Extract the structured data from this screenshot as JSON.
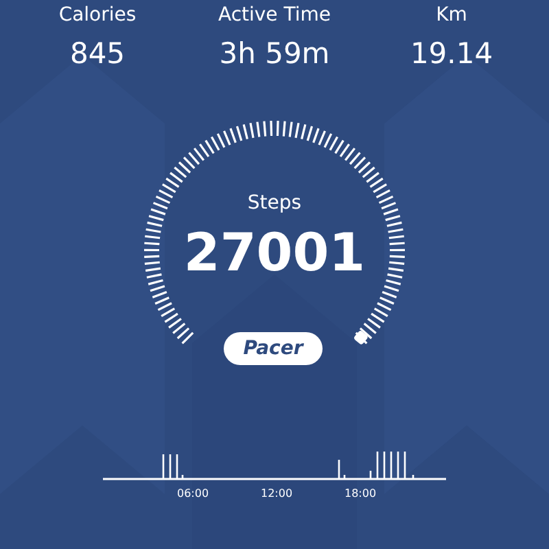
{
  "stats": [
    {
      "label": "Calories",
      "value": "845"
    },
    {
      "label": "Active Time",
      "value": "3h 59m"
    },
    {
      "label": "Km",
      "value": "19.14"
    }
  ],
  "gauge": {
    "label": "Steps",
    "value": "27001"
  },
  "brand": "Pacer",
  "activity_chart": {
    "x_labels": [
      "06:00",
      "12:00",
      "18:00"
    ]
  }
}
